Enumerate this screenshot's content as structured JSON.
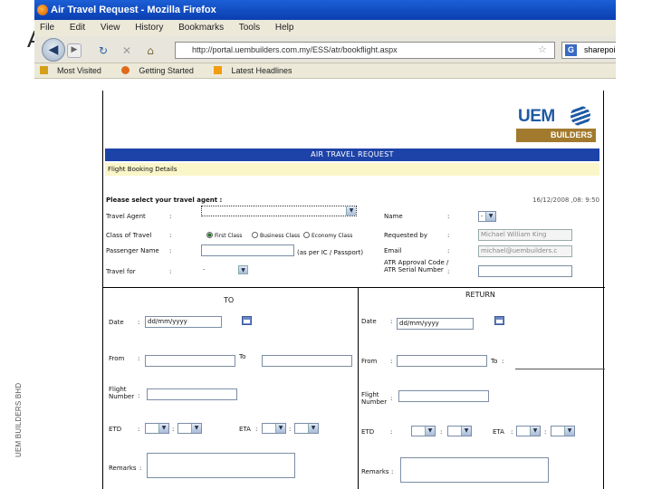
{
  "slide": {
    "letter": "A",
    "side_label": "UEM BUILDERS BHD"
  },
  "browser": {
    "title": "Air Travel Request - Mozilla Firefox",
    "menu": [
      "File",
      "Edit",
      "View",
      "History",
      "Bookmarks",
      "Tools",
      "Help"
    ],
    "url": "http://portal.uembuilders.com.my/ESS/atr/bookflight.aspx",
    "search_value": "sharepoint",
    "bookmarks": [
      "Most Visited",
      "Getting Started",
      "Latest Headlines"
    ]
  },
  "logo": {
    "top": "UEM",
    "bottom": "BUILDERS"
  },
  "form": {
    "header": "AIR TRAVEL REQUEST",
    "section": "Flight Booking Details",
    "select_agent": "Please select your travel agent :",
    "datetime": "16/12/2008 ,08: 9:50",
    "left": {
      "travel_agent": "Travel Agent",
      "class": "Class of Travel",
      "class_options": [
        "First Class",
        "Business Class",
        "Economy Class"
      ],
      "passenger": "Passenger Name",
      "passenger_hint": "(as per IC / Passport)",
      "travel_for": "Travel for",
      "travel_for_value": "-"
    },
    "right": {
      "name": "Name",
      "name_value": "-",
      "requested_by": "Requested by",
      "requested_by_value": "Michael William King",
      "email": "Email",
      "email_value": "michael@uembuilders.c",
      "atr": "ATR Approval Code / ATR Serial Number"
    },
    "to": {
      "heading": "TO",
      "date": "Date",
      "date_placeholder": "dd/mm/yyyy",
      "from": "From",
      "to": "To",
      "flight": "Flight Number",
      "etd": "ETD",
      "eta": "ETA",
      "remarks": "Remarks"
    },
    "return": {
      "heading": "RETURN",
      "date": "Date",
      "date_placeholder": "dd/mm/yyyy",
      "from": "From",
      "to": "To",
      "flight": "Flight Number",
      "etd": "ETD",
      "eta": "ETA",
      "remarks": "Remarks"
    },
    "colon": ":"
  }
}
